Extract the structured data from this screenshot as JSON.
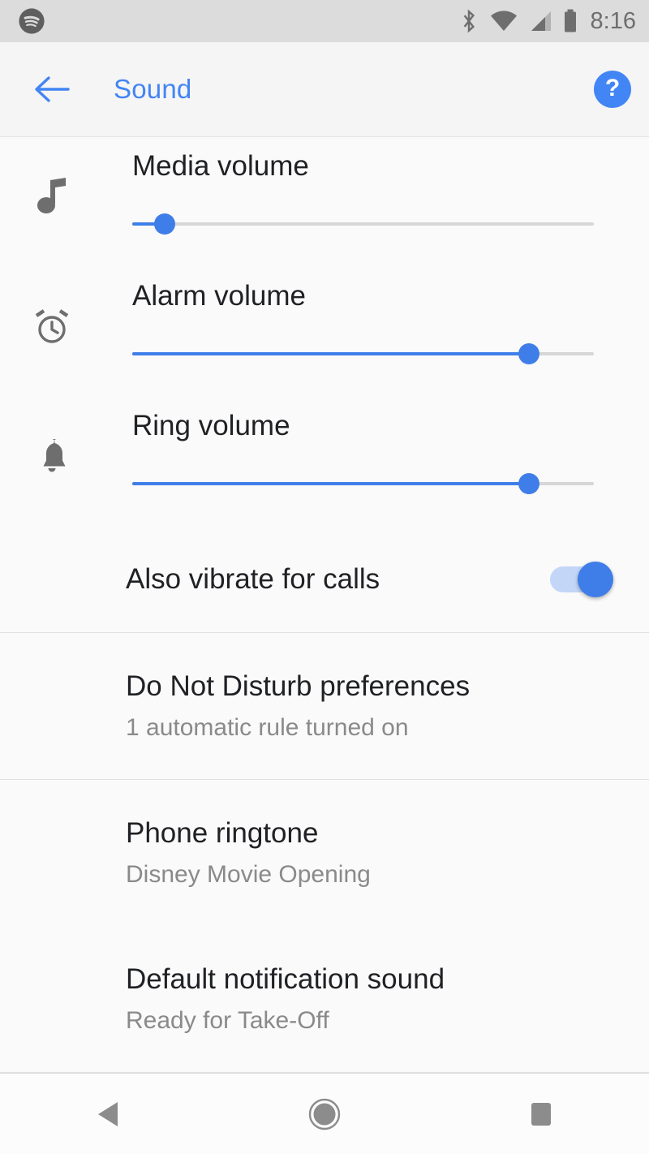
{
  "status_bar": {
    "time": "8:16",
    "app_notification_icon": "spotify-icon",
    "icons": [
      "bluetooth-icon",
      "wifi-icon",
      "cellular-signal-icon",
      "battery-icon"
    ],
    "background_color": "#dcdcdc",
    "foreground_color": "#6e6e6e"
  },
  "app_bar": {
    "back_label": "back-arrow",
    "title": "Sound",
    "help_label": "?",
    "accent_color": "#4285f4"
  },
  "volume_settings": [
    {
      "icon": "music-note-icon",
      "label": "Media volume",
      "value_percent": 7
    },
    {
      "icon": "alarm-clock-icon",
      "label": "Alarm volume",
      "value_percent": 86
    },
    {
      "icon": "bell-icon",
      "label": "Ring volume",
      "value_percent": 86
    }
  ],
  "vibrate_setting": {
    "label": "Also vibrate for calls",
    "state": "on",
    "track_color": "#c3d6f8",
    "thumb_color": "#3f7ee8"
  },
  "preferences": [
    {
      "title": "Do Not Disturb preferences",
      "subtitle": "1 automatic rule turned on"
    },
    {
      "title": "Phone ringtone",
      "subtitle": "Disney Movie Opening"
    },
    {
      "title": "Default notification sound",
      "subtitle": "Ready for Take-Off"
    }
  ],
  "nav_bar": {
    "back": "back-triangle-icon",
    "home": "home-circle-icon",
    "recents": "recents-square-icon",
    "icon_color": "#8c8c8c"
  }
}
